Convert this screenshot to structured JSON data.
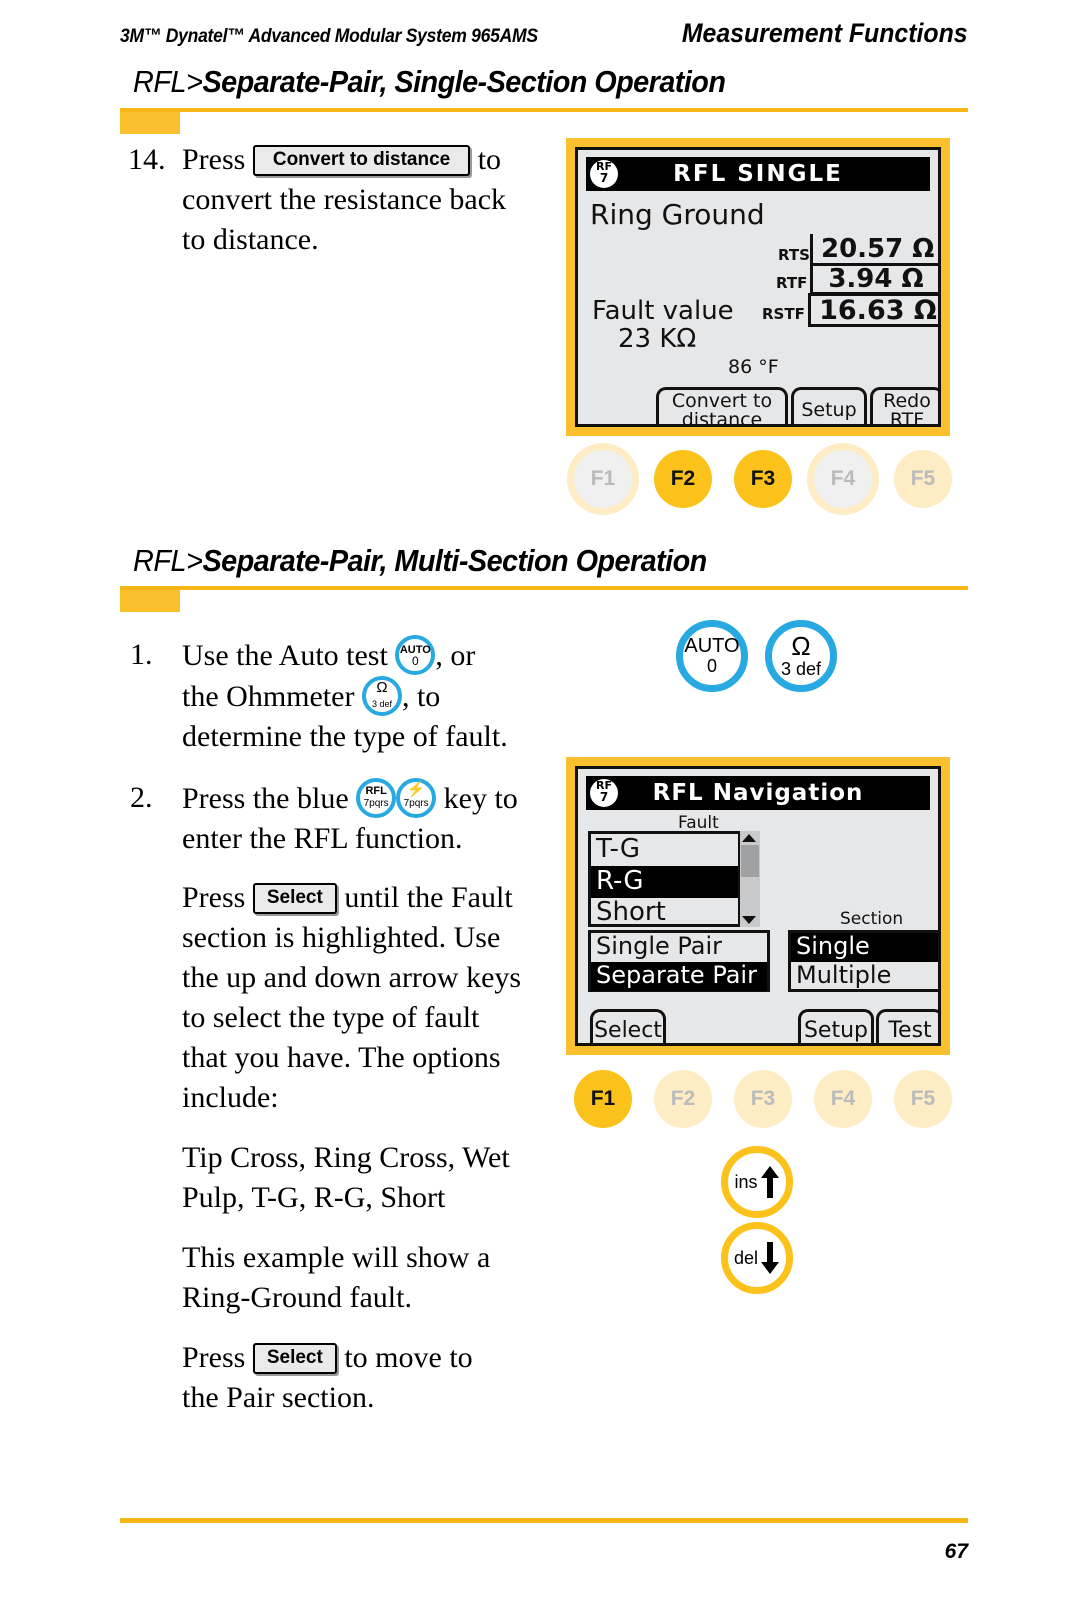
{
  "running_head": {
    "left": "3M™ Dynatel™ Advanced Modular System 965AMS",
    "right": "Measurement Functions"
  },
  "sections": [
    {
      "prefix": "RFL>",
      "title": "Separate-Pair, Single-Section Operation"
    },
    {
      "prefix": "RFL>",
      "title": "Separate-Pair, Multi-Section Operation"
    }
  ],
  "section1": {
    "step14": {
      "number": "14.",
      "text_before": "Press",
      "button": "Convert to distance",
      "text_after": "to",
      "line2": "convert the resistance back",
      "line3": "to distance."
    },
    "screen": {
      "rf_badge_top": "RF",
      "rf_badge_bottom": "7",
      "title": "RFL SINGLE",
      "fault_type": "Ring Ground",
      "rows": [
        {
          "label": "RTS",
          "value": "20.57 Ω"
        },
        {
          "label": "RTF",
          "value": "3.94 Ω"
        },
        {
          "label": "RSTF",
          "value": "16.63 Ω"
        }
      ],
      "fault_value_label": "Fault value",
      "fault_value": "23 KΩ",
      "temperature": "86 °F",
      "softkeys": [
        {
          "line1": "Convert to",
          "line2": "distance"
        },
        {
          "line1": "Setup",
          "line2": ""
        },
        {
          "line1": "Redo",
          "line2": "RTF"
        }
      ]
    },
    "fkeys": [
      {
        "label": "F1",
        "state": "off-grey"
      },
      {
        "label": "F2",
        "state": "on"
      },
      {
        "label": "F3",
        "state": "on"
      },
      {
        "label": "F4",
        "state": "off-grey"
      },
      {
        "label": "F5",
        "state": "off"
      }
    ]
  },
  "section2": {
    "step1": {
      "number": "1.",
      "line1_a": "Use the Auto test",
      "key1_top": "AUTO",
      "key1_bottom": "0",
      "line1_b": ", or",
      "line2_a": "the Ohmmeter",
      "key2_top": "Ω",
      "key2_bottom": "3 def",
      "line2_b": ", to",
      "line3": "determine the type of fault."
    },
    "step2": {
      "number": "2.",
      "line1_a": "Press the blue",
      "key1_top": "RFL",
      "key1_bottom": "7pqrs",
      "key2_top": "⚡",
      "key2_bottom": "7pqrs",
      "line1_b": "key to",
      "line2": "enter the RFL function."
    },
    "para1": {
      "text_before": "Press",
      "button": "Select",
      "text_after": "until the Fault",
      "line2": "section is highlighted. Use",
      "line3": "the up and down arrow keys",
      "line4": "to select the type of fault",
      "line5": "that you have. The options",
      "line6": "include:"
    },
    "para2": {
      "line1": "Tip Cross, Ring Cross, Wet",
      "line2": "Pulp, T-G, R-G, Short"
    },
    "para3": {
      "line1": "This example will show a",
      "line2": "Ring-Ground fault."
    },
    "para4": {
      "text_before": "Press",
      "button": "Select",
      "text_after": "to move to",
      "line2": "the Pair section."
    },
    "margin_keys": [
      {
        "name": "auto-key",
        "top": "AUTO",
        "bottom": "0",
        "color": "#28a9e2"
      },
      {
        "name": "ohm-key",
        "top": "Ω",
        "bottom": "3 def",
        "color": "#28a9e2"
      },
      {
        "name": "ins-up-key",
        "tag": "ins",
        "arrow": "up",
        "color": "#fcc21c"
      },
      {
        "name": "del-down-key",
        "tag": "del",
        "arrow": "down",
        "color": "#fcc21c"
      }
    ],
    "screen": {
      "rf_badge_top": "RF",
      "rf_badge_bottom": "7",
      "title": "RFL Navigation",
      "fault_group_label": "Fault",
      "section_group_label": "Section",
      "fault_options": [
        {
          "label": "T-G",
          "selected": false
        },
        {
          "label": "R-G",
          "selected": true
        },
        {
          "label": "Short",
          "selected": false
        }
      ],
      "pair_options": [
        {
          "label": "Single Pair",
          "selected": false
        },
        {
          "label": "Separate Pair",
          "selected": true
        }
      ],
      "section_options": [
        {
          "label": "Single",
          "selected": true
        },
        {
          "label": "Multiple",
          "selected": false
        }
      ],
      "softkeys": [
        {
          "line1": "Select"
        },
        {
          "line1": "Setup"
        },
        {
          "line1": "Test"
        }
      ]
    },
    "fkeys": [
      {
        "label": "F1",
        "state": "on"
      },
      {
        "label": "F2",
        "state": "off"
      },
      {
        "label": "F3",
        "state": "off"
      },
      {
        "label": "F4",
        "state": "off"
      },
      {
        "label": "F5",
        "state": "off"
      }
    ]
  },
  "footer": {
    "page_number": "67"
  },
  "colors": {
    "accent_yellow": "#fbc02d",
    "rule_yellow": "#f6b618",
    "key_blue": "#28a9e2",
    "lcd_bg": "#e6e7e9"
  }
}
